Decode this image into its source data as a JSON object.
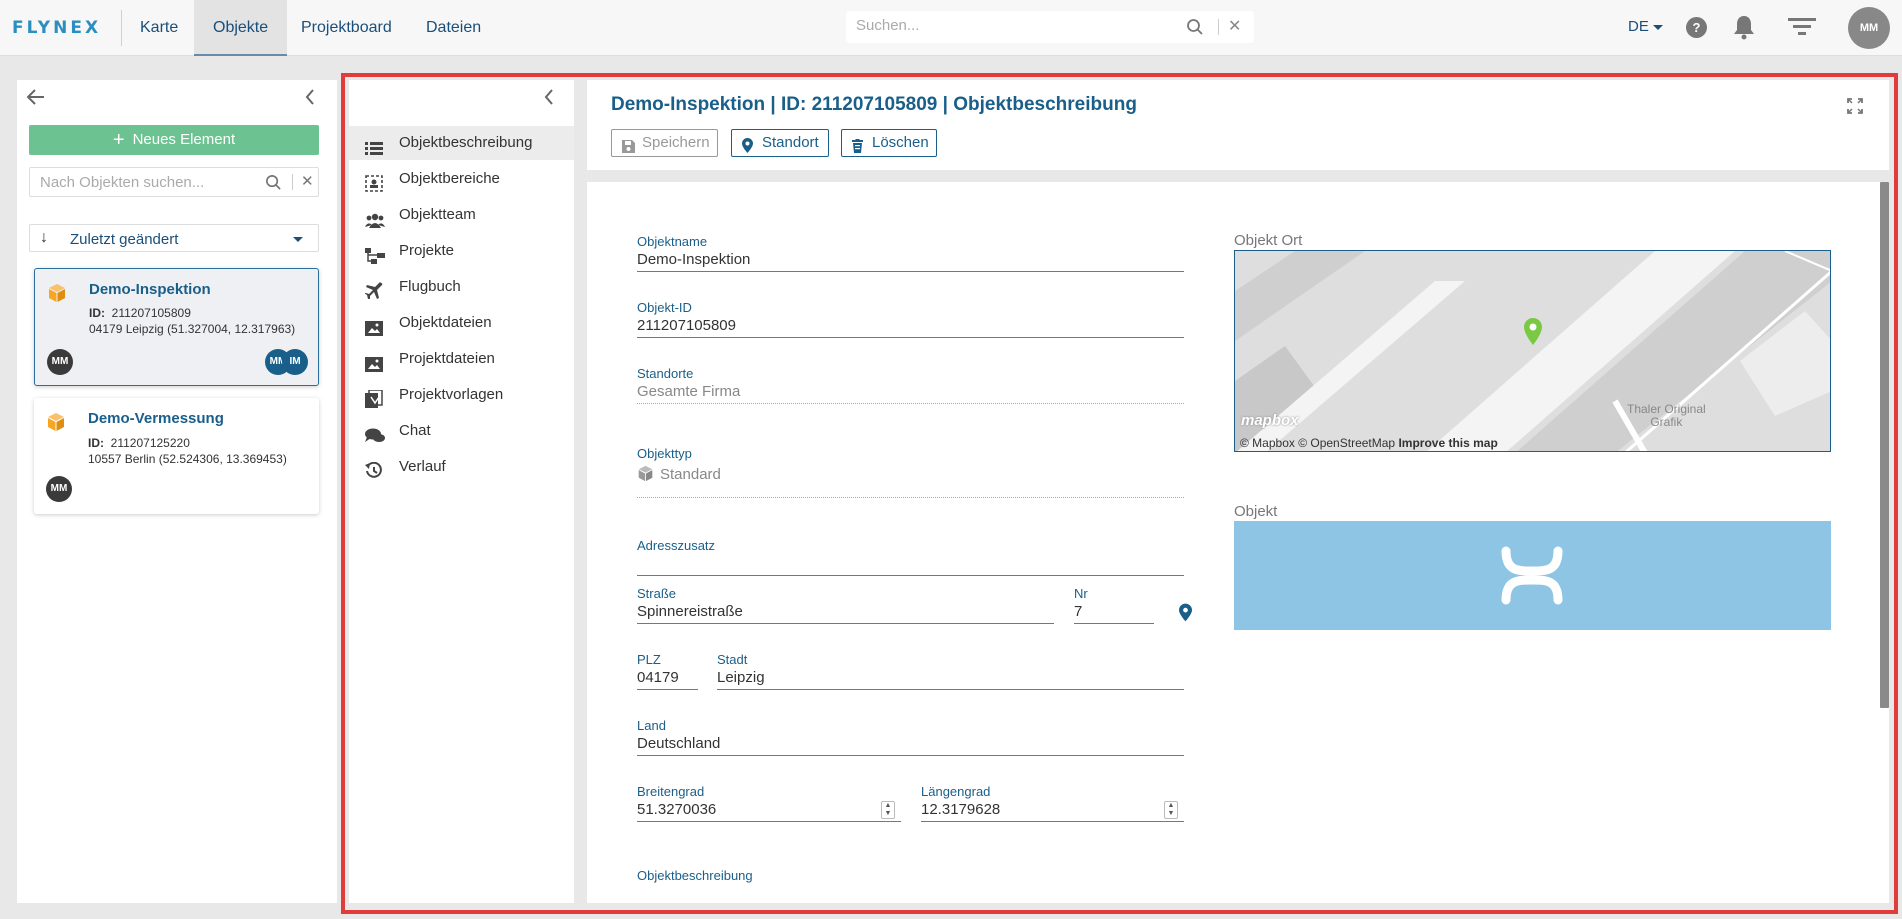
{
  "app": {
    "logo": "FLYNEX"
  },
  "nav": {
    "tabs": [
      {
        "label": "Karte"
      },
      {
        "label": "Objekte"
      },
      {
        "label": "Projektboard"
      },
      {
        "label": "Dateien"
      }
    ],
    "active": "Objekte"
  },
  "search": {
    "placeholder": "Suchen..."
  },
  "topright": {
    "language": "DE",
    "help": "?",
    "avatar": "MM"
  },
  "left": {
    "new_button": "Neues Element",
    "search_placeholder": "Nach Objekten suchen...",
    "sort_label": "Zuletzt geändert",
    "cards": [
      {
        "title": "Demo-Inspektion",
        "id_label": "ID:",
        "id": "211207105809",
        "address": "04179 Leipzig (51.327004, 12.317963)",
        "owner": "MM",
        "members": [
          "MM",
          "IM"
        ]
      },
      {
        "title": "Demo-Vermessung",
        "id_label": "ID:",
        "id": "211207125220",
        "address": "10557 Berlin (52.524306, 13.369453)",
        "owner": "MM"
      }
    ]
  },
  "sidemenu": {
    "items": [
      {
        "label": "Objektbeschreibung",
        "icon": "list-icon"
      },
      {
        "label": "Objektbereiche",
        "icon": "area-icon"
      },
      {
        "label": "Objektteam",
        "icon": "team-icon"
      },
      {
        "label": "Projekte",
        "icon": "projects-icon"
      },
      {
        "label": "Flugbuch",
        "icon": "airplane-icon"
      },
      {
        "label": "Objektdateien",
        "icon": "image-folder-icon"
      },
      {
        "label": "Projektdateien",
        "icon": "image-folder-icon"
      },
      {
        "label": "Projektvorlagen",
        "icon": "template-icon"
      },
      {
        "label": "Chat",
        "icon": "chat-icon"
      },
      {
        "label": "Verlauf",
        "icon": "history-icon"
      }
    ]
  },
  "header": {
    "title": "Demo-Inspektion | ID: 211207105809 | Objektbeschreibung",
    "buttons": {
      "save": "Speichern",
      "location": "Standort",
      "delete": "Löschen"
    }
  },
  "form": {
    "objektname": {
      "label": "Objektname",
      "value": "Demo-Inspektion"
    },
    "objekt_id": {
      "label": "Objekt-ID",
      "value": "211207105809"
    },
    "standorte": {
      "label": "Standorte",
      "value": "Gesamte Firma"
    },
    "objekttyp": {
      "label": "Objekttyp",
      "value": "Standard"
    },
    "adresszusatz": {
      "label": "Adresszusatz",
      "value": ""
    },
    "strasse": {
      "label": "Straße",
      "value": "Spinnereistraße"
    },
    "nr": {
      "label": "Nr",
      "value": "7"
    },
    "plz": {
      "label": "PLZ",
      "value": "04179"
    },
    "stadt": {
      "label": "Stadt",
      "value": "Leipzig"
    },
    "land": {
      "label": "Land",
      "value": "Deutschland"
    },
    "breitengrad": {
      "label": "Breitengrad",
      "value": "51.3270036"
    },
    "laengengrad": {
      "label": "Längengrad",
      "value": "12.3179628"
    },
    "objektbeschreibung": {
      "label": "Objektbeschreibung"
    }
  },
  "map": {
    "label": "Objekt Ort",
    "logo": "mapbox",
    "attribution": "© Mapbox © OpenStreetMap",
    "improve": "Improve this map",
    "place_line1": "Thaler Original",
    "place_line2": "Grafik"
  },
  "objekt_image": {
    "label": "Objekt"
  },
  "colors": {
    "brand": "#1a5f8a",
    "accent_green": "#6cc391",
    "highlight": "#e03c3c",
    "cube_orange": "#f5a623"
  }
}
